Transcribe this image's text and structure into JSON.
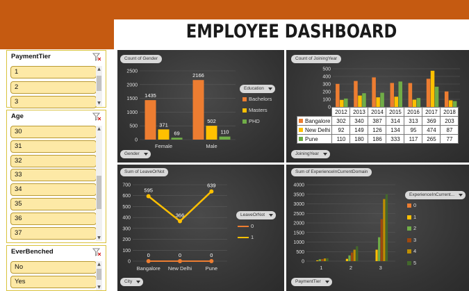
{
  "dashboard": {
    "title": "EMPLOYEE DASHBOARD"
  },
  "colors": {
    "orange": "#ed7d31",
    "yellow": "#ffc000",
    "green": "#70ad47",
    "header": "#c55a11"
  },
  "slicers": {
    "payment_tier": {
      "header": "PaymentTier",
      "items": [
        "1",
        "2",
        "3"
      ]
    },
    "age": {
      "header": "Age",
      "items": [
        "30",
        "31",
        "32",
        "33",
        "34",
        "35",
        "36",
        "37"
      ]
    },
    "ever_benched": {
      "header": "EverBenched",
      "items": [
        "No",
        "Yes"
      ]
    }
  },
  "gender_chart": {
    "field_pill": "Count of Gender",
    "axis_pill": "Gender",
    "legend_title": "Education",
    "chart_data": {
      "type": "bar",
      "categories": [
        "Female",
        "Male"
      ],
      "series": [
        {
          "name": "Bachelors",
          "values": [
            1435,
            2166
          ]
        },
        {
          "name": "Masters",
          "values": [
            371,
            502
          ]
        },
        {
          "name": "PHD",
          "values": [
            69,
            110
          ]
        }
      ],
      "ylim": [
        0,
        2500
      ],
      "yticks": [
        "0",
        "500",
        "1000",
        "1500",
        "2000",
        "2500"
      ],
      "grid": true,
      "legend": "right"
    }
  },
  "joining_chart": {
    "field_pill": "Count of JoiningYear",
    "axis_pill": "JoiningYear",
    "chart_data": {
      "type": "bar",
      "categories": [
        "2012",
        "2013",
        "2014",
        "2015",
        "2016",
        "2017",
        "2018"
      ],
      "series": [
        {
          "name": "Bangalore",
          "values": [
            302,
            340,
            387,
            314,
            313,
            369,
            203
          ]
        },
        {
          "name": "New Delhi",
          "values": [
            92,
            149,
            126,
            134,
            95,
            474,
            87
          ]
        },
        {
          "name": "Pune",
          "values": [
            110,
            180,
            186,
            333,
            117,
            265,
            77
          ]
        }
      ],
      "ylim": [
        0,
        500
      ],
      "yticks": [
        "0",
        "100",
        "200",
        "300",
        "400",
        "500"
      ],
      "grid": true,
      "legend": "table"
    }
  },
  "leave_chart": {
    "field_pill": "Sum of LeaveOrNot",
    "axis_pill": "City",
    "legend_title": "LeaveOrNot",
    "chart_data": {
      "type": "line",
      "categories": [
        "Bangalore",
        "New Delhi",
        "Pune"
      ],
      "series": [
        {
          "name": "0",
          "values": [
            0,
            0,
            0
          ]
        },
        {
          "name": "1",
          "values": [
            595,
            366,
            639
          ]
        }
      ],
      "ylim": [
        0,
        700
      ],
      "yticks": [
        "0",
        "100",
        "200",
        "300",
        "400",
        "500",
        "600",
        "700"
      ],
      "grid": true,
      "legend": "right"
    }
  },
  "experience_chart": {
    "field_pill": "Sum of ExperienceInCurrentDomain",
    "axis_pill": "PaymentTier",
    "legend_title": "ExperienceInCurrent...",
    "chart_data": {
      "type": "bar",
      "categories": [
        "1",
        "2",
        "3"
      ],
      "series": [
        {
          "name": "0",
          "values": [
            0,
            0,
            0
          ]
        },
        {
          "name": "1",
          "values": [
            40,
            120,
            600
          ]
        },
        {
          "name": "2",
          "values": [
            100,
            300,
            1250
          ]
        },
        {
          "name": "3",
          "values": [
            110,
            450,
            2200
          ]
        },
        {
          "name": "4",
          "values": [
            140,
            600,
            3250
          ]
        },
        {
          "name": "5",
          "values": [
            150,
            780,
            3500
          ]
        }
      ],
      "ylim": [
        0,
        4000
      ],
      "yticks": [
        "0",
        "500",
        "1000",
        "1500",
        "2000",
        "2500",
        "3000",
        "3500",
        "4000"
      ],
      "grid": true,
      "legend": "right"
    }
  }
}
